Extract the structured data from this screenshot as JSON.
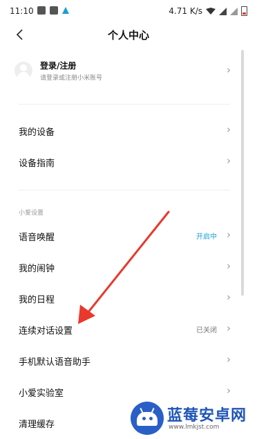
{
  "status_bar": {
    "time": "11:10",
    "speed": "4.71 K/s"
  },
  "header": {
    "title": "个人中心",
    "back_icon": "chevron-left-icon"
  },
  "login": {
    "title": "登录/注册",
    "subtitle": "请登录或注册小米账号"
  },
  "devices": [
    {
      "label": "我的设备"
    },
    {
      "label": "设备指南"
    }
  ],
  "section": {
    "title": "小爱设置"
  },
  "settings": [
    {
      "label": "语音唤醒",
      "status": "开启中"
    },
    {
      "label": "我的闹钟",
      "status": ""
    },
    {
      "label": "我的日程",
      "status": ""
    },
    {
      "label": "连续对话设置",
      "status": "已关闭"
    },
    {
      "label": "手机默认语音助手",
      "status": ""
    },
    {
      "label": "小爱实验室",
      "status": ""
    },
    {
      "label": "清理缓存",
      "status": ""
    }
  ],
  "watermark": {
    "title": "蓝莓安卓网",
    "url": "www.lmkjst.com"
  },
  "colors": {
    "accent": "#1a9fd6",
    "annotation_arrow": "#e8392c",
    "watermark_blue": "#2a5fc7"
  }
}
